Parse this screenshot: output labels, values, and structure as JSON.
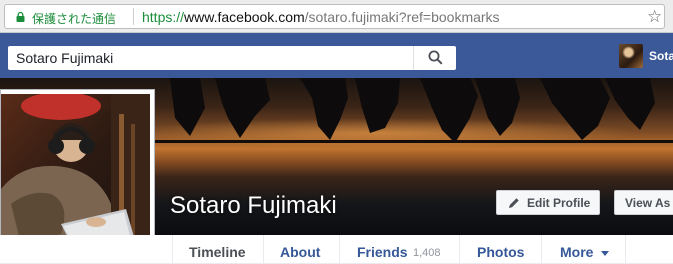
{
  "browser": {
    "secure_label": "保護された通信",
    "url_scheme": "https://",
    "url_host": "www.facebook.com",
    "url_path": "/sotaro.fujimaki?ref=bookmarks",
    "bookmark_icon": "star-icon"
  },
  "header": {
    "search_value": "Sotaro Fujimaki",
    "search_icon": "search-icon",
    "username": "Sota"
  },
  "cover": {
    "name": "Sotaro Fujimaki",
    "edit_profile_label": "Edit Profile",
    "view_as_label": "View As"
  },
  "tabs": [
    {
      "label": "Timeline",
      "active": true
    },
    {
      "label": "About"
    },
    {
      "label": "Friends",
      "count": "1,408"
    },
    {
      "label": "Photos"
    },
    {
      "label": "More",
      "has_caret": true
    }
  ],
  "colors": {
    "facebook_blue": "#3b5998",
    "link_blue": "#365899",
    "secure_green": "#1b8d3a"
  }
}
